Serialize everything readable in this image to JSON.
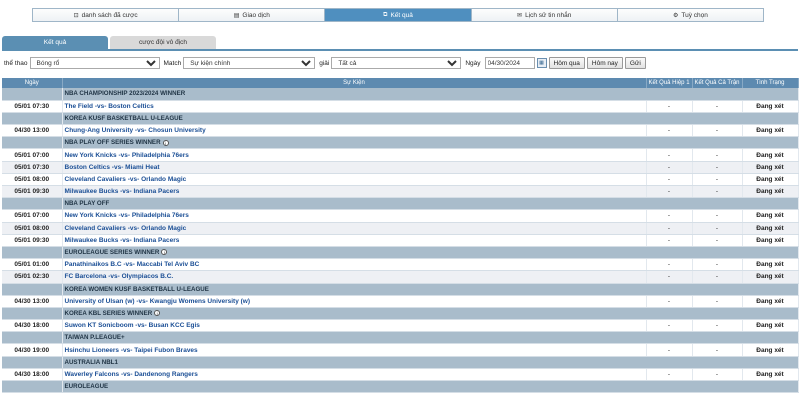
{
  "nav": {
    "items": [
      {
        "label": "danh sách đã cược",
        "icon": "list-icon",
        "glyph": "⊡",
        "active": false
      },
      {
        "label": "Giao dịch",
        "icon": "transaction-icon",
        "glyph": "▤",
        "active": false
      },
      {
        "label": "Kết quả",
        "icon": "results-icon",
        "glyph": "⧉",
        "active": true
      },
      {
        "label": "Lịch sử tin nhắn",
        "icon": "mail-icon",
        "glyph": "✉",
        "active": false
      },
      {
        "label": "Tuỳ chọn",
        "icon": "gear-icon",
        "glyph": "⚙",
        "active": false
      }
    ]
  },
  "subtabs": [
    {
      "label": "Kết quả",
      "active": true
    },
    {
      "label": "cược đội vô địch",
      "active": false
    }
  ],
  "filters": {
    "sport_label": "thể thao",
    "sport_value": "Bóng rổ",
    "match_label": "Match",
    "match_value": "Sự kiện chính",
    "league_label": "giải",
    "league_value": "Tất cả",
    "date_label": "Ngày",
    "date_value": "04/30/2024",
    "yesterday_button": "Hôm qua",
    "today_button": "Hôm nay",
    "submit_button": "Gửi"
  },
  "table": {
    "headers": [
      "Ngày",
      "Sự Kiện",
      "Kết Quả Hiệp 1",
      "Kết Quả Cả Trận",
      "Tình Trạng"
    ],
    "rows": [
      {
        "type": "league",
        "name": "NBA CHAMPIONSHIP 2023/2024 WINNER"
      },
      {
        "type": "match",
        "date": "05/01 07:30",
        "teams": "The Field -vs- Boston Celtics",
        "h1": "-",
        "ft": "-",
        "status": "Đang xét"
      },
      {
        "type": "league",
        "name": "KOREA KUSF BASKETBALL U-LEAGUE"
      },
      {
        "type": "match",
        "date": "04/30 13:00",
        "teams": "Chung-Ang University -vs- Chosun University",
        "h1": "-",
        "ft": "-",
        "status": "Đang xét"
      },
      {
        "type": "league",
        "name": "NBA PLAY OFF SERIES WINNER",
        "info": true
      },
      {
        "type": "match",
        "date": "05/01 07:00",
        "teams": "New York Knicks -vs- Philadelphia 76ers",
        "h1": "-",
        "ft": "-",
        "status": "Đang xét"
      },
      {
        "type": "match",
        "date": "05/01 07:30",
        "teams": "Boston Celtics -vs- Miami Heat",
        "h1": "-",
        "ft": "-",
        "status": "Đang xét"
      },
      {
        "type": "match",
        "date": "05/01 08:00",
        "teams": "Cleveland Cavaliers -vs- Orlando Magic",
        "h1": "-",
        "ft": "-",
        "status": "Đang xét"
      },
      {
        "type": "match",
        "date": "05/01 09:30",
        "teams": "Milwaukee Bucks -vs- Indiana Pacers",
        "h1": "-",
        "ft": "-",
        "status": "Đang xét"
      },
      {
        "type": "league",
        "name": "NBA PLAY OFF"
      },
      {
        "type": "match",
        "date": "05/01 07:00",
        "teams": "New York Knicks -vs- Philadelphia 76ers",
        "h1": "-",
        "ft": "-",
        "status": "Đang xét"
      },
      {
        "type": "match",
        "date": "05/01 08:00",
        "teams": "Cleveland Cavaliers -vs- Orlando Magic",
        "h1": "-",
        "ft": "-",
        "status": "Đang xét"
      },
      {
        "type": "match",
        "date": "05/01 09:30",
        "teams": "Milwaukee Bucks -vs- Indiana Pacers",
        "h1": "-",
        "ft": "-",
        "status": "Đang xét"
      },
      {
        "type": "league",
        "name": "EUROLEAGUE SERIES WINNER",
        "info": true
      },
      {
        "type": "match",
        "date": "05/01 01:00",
        "teams": "Panathinaikos B.C -vs- Maccabi Tel Aviv BC",
        "h1": "-",
        "ft": "-",
        "status": "Đang xét"
      },
      {
        "type": "match",
        "date": "05/01 02:30",
        "teams": "FC Barcelona -vs- Olympiacos B.C.",
        "h1": "-",
        "ft": "-",
        "status": "Đang xét"
      },
      {
        "type": "league",
        "name": "KOREA WOMEN KUSF BASKETBALL U-LEAGUE"
      },
      {
        "type": "match",
        "date": "04/30 13:00",
        "teams": "University of Ulsan (w) -vs- Kwangju Womens University (w)",
        "h1": "-",
        "ft": "-",
        "status": "Đang xét"
      },
      {
        "type": "league",
        "name": "KOREA KBL SERIES WINNER",
        "info": true
      },
      {
        "type": "match",
        "date": "04/30 18:00",
        "teams": "Suwon KT Sonicboom -vs- Busan KCC Egis",
        "h1": "-",
        "ft": "-",
        "status": "Đang xét"
      },
      {
        "type": "league",
        "name": "TAIWAN P.LEAGUE+"
      },
      {
        "type": "match",
        "date": "04/30 19:00",
        "teams": "Hsinchu Lioneers -vs- Taipei Fubon Braves",
        "h1": "-",
        "ft": "-",
        "status": "Đang xét"
      },
      {
        "type": "league",
        "name": "AUSTRALIA NBL1"
      },
      {
        "type": "match",
        "date": "04/30 18:00",
        "teams": "Waverley Falcons -vs- Dandenong Rangers",
        "h1": "-",
        "ft": "-",
        "status": "Đang xét"
      },
      {
        "type": "league",
        "name": "EUROLEAGUE"
      }
    ]
  }
}
